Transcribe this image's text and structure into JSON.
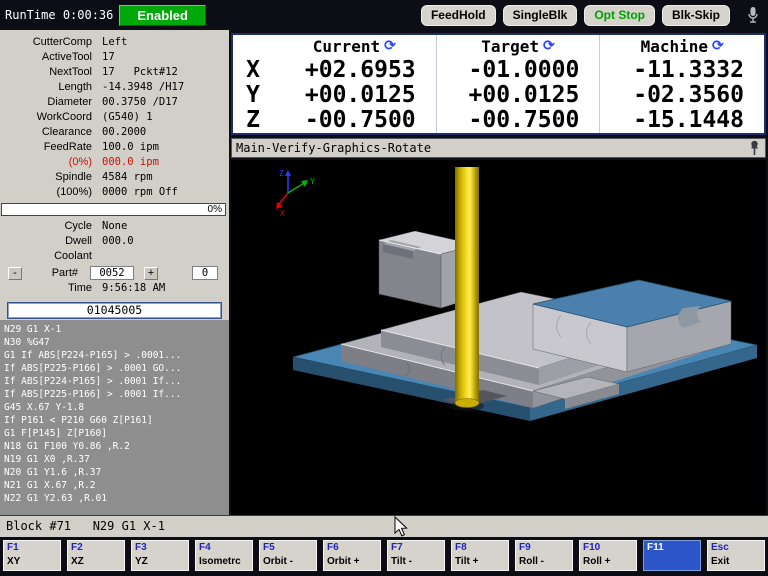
{
  "top_bar": {
    "runtime_label": "RunTime",
    "runtime_value": "0:00:36",
    "enabled_label": "Enabled",
    "buttons": {
      "feedhold": "FeedHold",
      "singleblk": "SingleBlk",
      "optstop": "Opt Stop",
      "blkskip": "Blk-Skip"
    }
  },
  "status": {
    "rows": [
      {
        "label": "CutterComp",
        "value": "Left"
      },
      {
        "label": "ActiveTool",
        "value": "17"
      },
      {
        "label": "NextTool",
        "value": "17   Pckt#12"
      },
      {
        "label": "Length",
        "value": "-14.3948 /H17"
      },
      {
        "label": "Diameter",
        "value": "00.3750 /D17"
      },
      {
        "label": "WorkCoord",
        "value": "(G540) 1"
      },
      {
        "label": "Clearance",
        "value": "00.2000"
      },
      {
        "label": "FeedRate",
        "value": "100.0 ipm"
      },
      {
        "label": "(0%)",
        "value": "000.0 ipm"
      },
      {
        "label": "Spindle",
        "value": "4584 rpm"
      },
      {
        "label": "(100%)",
        "value": "0000 rpm Off"
      }
    ],
    "spindle_load": "0%",
    "cycle_label": "Cycle",
    "cycle_value": "None",
    "dwell_label": "Dwell",
    "dwell_value": "000.0",
    "coolant_label": "Coolant",
    "coolant_value": "",
    "part_minus": "-",
    "part_label": "Part#",
    "part_value": "0052",
    "part_plus": "+",
    "part_count": "0",
    "time_label": "Time",
    "time_value": "9:56:18 AM",
    "program_name": "01045005"
  },
  "code": {
    "lines": [
      "N29 G1 X-1",
      "N30 %G47",
      "G1 If ABS[P224-P165] > .0001...",
      "If ABS[P225-P166] > .0001 GO...",
      "If ABS[P224-P165] > .0001 If...",
      "If ABS[P225-P166] > .0001 If...",
      "G45 X.67 Y-1.8",
      "If P161 < P210 G60 Z[P161]",
      "G1 F[P145] Z[P160]",
      "N18 G1 F100 Y0.86 ,R.2",
      "N19 G1 X0 ,R.37",
      "N20 G1 Y1.6 ,R.37",
      "N21 G1 X.67 ,R.2",
      "N22 G1 Y2.63 ,R.01"
    ]
  },
  "dro": {
    "headers": [
      "Current",
      "Target",
      "Machine"
    ],
    "rows": [
      {
        "axis": "X",
        "current": "+02.6953",
        "target": "-01.0000",
        "machine": "-11.3332"
      },
      {
        "axis": "Y",
        "current": "+00.0125",
        "target": "+00.0125",
        "machine": "-02.3560"
      },
      {
        "axis": "Z",
        "current": "-00.7500",
        "target": "-00.7500",
        "machine": "-15.1448"
      }
    ]
  },
  "menu": {
    "title": "Main-Verify-Graphics-Rotate"
  },
  "graphics": {
    "axis_labels": {
      "x": "X",
      "y": "Y",
      "z": "Z"
    }
  },
  "block_bar": {
    "text": "Block #71   N29 G1 X-1"
  },
  "fkeys": [
    {
      "key": "F1",
      "label": "XY"
    },
    {
      "key": "F2",
      "label": "XZ"
    },
    {
      "key": "F3",
      "label": "YZ"
    },
    {
      "key": "F4",
      "label": "Isometrc"
    },
    {
      "key": "F5",
      "label": "Orbit -"
    },
    {
      "key": "F6",
      "label": "Orbit +"
    },
    {
      "key": "F7",
      "label": "Tilt -"
    },
    {
      "key": "F8",
      "label": "Tilt +"
    },
    {
      "key": "F9",
      "label": "Roll -"
    },
    {
      "key": "F10",
      "label": "Roll +"
    },
    {
      "key": "F11",
      "label": ""
    },
    {
      "key": "Esc",
      "label": "Exit"
    }
  ],
  "icons": {
    "refresh": "⟳"
  },
  "colors": {
    "enabled_green": "#00a80a",
    "optstop_green": "#00a000",
    "alert_red": "#cc1100",
    "dro_border": "#1e2d6e",
    "f11_blue": "#2b55c8",
    "plate_blue": "#4a86b4",
    "tool_yellow": "#f2da20"
  }
}
